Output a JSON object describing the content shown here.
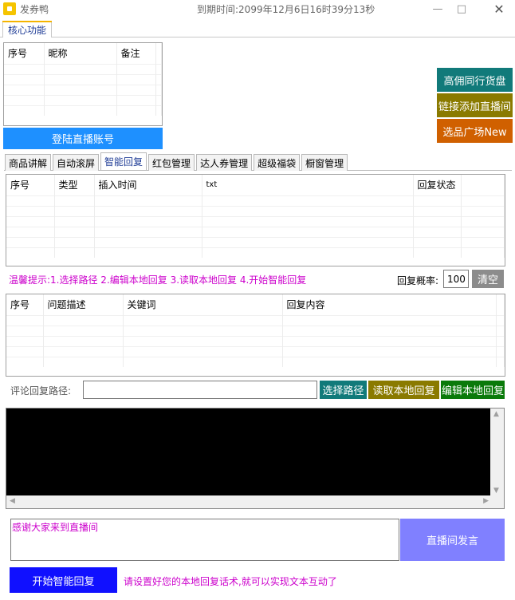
{
  "window": {
    "title": "发券鸭",
    "expiry": "到期时间:2099年12月6日16时39分13秒",
    "icons": [
      "app-logo-icon",
      "minimize-icon",
      "maximize-icon",
      "close-icon"
    ]
  },
  "core_tab": {
    "label": "核心功能"
  },
  "account_table": {
    "columns": [
      "序号",
      "昵称",
      "备注"
    ]
  },
  "login_button": "登陆直播账号",
  "side_buttons": {
    "peer_goods": "高佣同行货盘",
    "link_add": "链接添加直播间",
    "selection_square": "选品广场New"
  },
  "side_colors": {
    "peer_goods": "#117a7a",
    "link_add": "#8a7a00",
    "selection_square": "#d06000"
  },
  "function_tabs": [
    "商品讲解",
    "自动滚屏",
    "智能回复",
    "红包管理",
    "达人券管理",
    "超级福袋",
    "橱窗管理"
  ],
  "active_tab": "智能回复",
  "insert_table": {
    "columns": [
      "序号",
      "类型",
      "插入时间",
      "txt",
      "回复状态"
    ]
  },
  "hint_steps": "温馨提示:1.选择路径 2.编辑本地回复 3.读取本地回复 4.开始智能回复",
  "reply_probability": {
    "label": "回复概率:",
    "value": "100"
  },
  "clear_button": "清空",
  "qa_table": {
    "columns": [
      "序号",
      "问题描述",
      "关键词",
      "回复内容"
    ]
  },
  "path": {
    "label": "评论回复路径:",
    "value": "",
    "choose_button": "选择路径",
    "read_button": "读取本地回复",
    "edit_button": "编辑本地回复"
  },
  "message": {
    "text": "感谢大家来到直播间",
    "send_button": "直播间发言"
  },
  "start_button": "开始智能回复",
  "footer_hint": "请设置好您的本地回复话术,就可以实现文本互动了",
  "colors": {
    "blue_primary": "#1e90ff",
    "teal": "#117a7a",
    "olive": "#8a7a00",
    "green": "#0a7a0a",
    "magenta": "#cc00cc",
    "purple_button": "#8080ff",
    "start_blue": "#1010ff"
  }
}
